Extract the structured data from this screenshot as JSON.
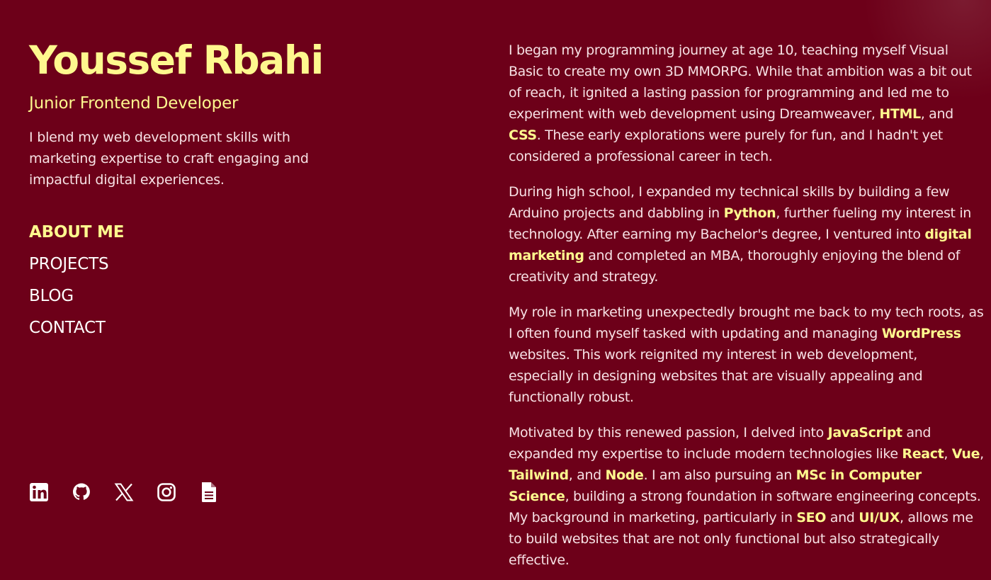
{
  "profile": {
    "name": "Youssef Rbahi",
    "role": "Junior Frontend Developer",
    "blurb": "I blend my web development skills with marketing expertise to craft engaging and impactful digital experiences."
  },
  "nav": {
    "items": [
      "ABOUT ME",
      "PROJECTS",
      "BLOG",
      "CONTACT"
    ],
    "active": "ABOUT ME"
  },
  "social": {
    "icons": [
      "linkedin-icon",
      "github-icon",
      "x-icon",
      "instagram-icon",
      "resume-icon"
    ]
  },
  "colors": {
    "background": "#6d0019",
    "accent": "#fef88e",
    "text": "#f7e1e5"
  },
  "about": {
    "p1": {
      "t1": "I began my programming journey at age 10, teaching myself Visual Basic to create my own 3D MMORPG. While that ambition was a bit out of reach, it ignited a lasting passion for programming and led me to experiment with web development using Dreamweaver, ",
      "h1": "HTML",
      "t2": ", and ",
      "h2": "CSS",
      "t3": ". These early explorations were purely for fun, and I hadn't yet considered a professional career in tech."
    },
    "p2": {
      "t1": "During high school, I expanded my technical skills by building a few Arduino projects and dabbling in ",
      "h1": "Python",
      "t2": ", further fueling my interest in technology. After earning my Bachelor's degree, I ventured into ",
      "h2": "digital marketing",
      "t3": " and completed an MBA, thoroughly enjoying the blend of creativity and strategy."
    },
    "p3": {
      "t1": "My role in marketing unexpectedly brought me back to my tech roots, as I often found myself tasked with updating and managing ",
      "h1": "WordPress",
      "t2": " websites. This work reignited my interest in web development, especially in designing websites that are visually appealing and functionally robust."
    },
    "p4": {
      "t1": "Motivated by this renewed passion, I delved into ",
      "h1": "JavaScript",
      "t2": " and expanded my expertise to include modern technologies like ",
      "h2": "React",
      "t3": ", ",
      "h3": "Vue",
      "t4": ", ",
      "h4": "Tailwind",
      "t5": ", and ",
      "h5": "Node",
      "t6": ". I am also pursuing an ",
      "h6": "MSc in Computer Science",
      "t7": ", building a strong foundation in software engineering concepts. My background in marketing, particularly in ",
      "h7": "SEO",
      "t8": " and ",
      "h8": "UI/UX",
      "t9": ", allows me to build websites that are not only functional but also strategically effective."
    }
  }
}
